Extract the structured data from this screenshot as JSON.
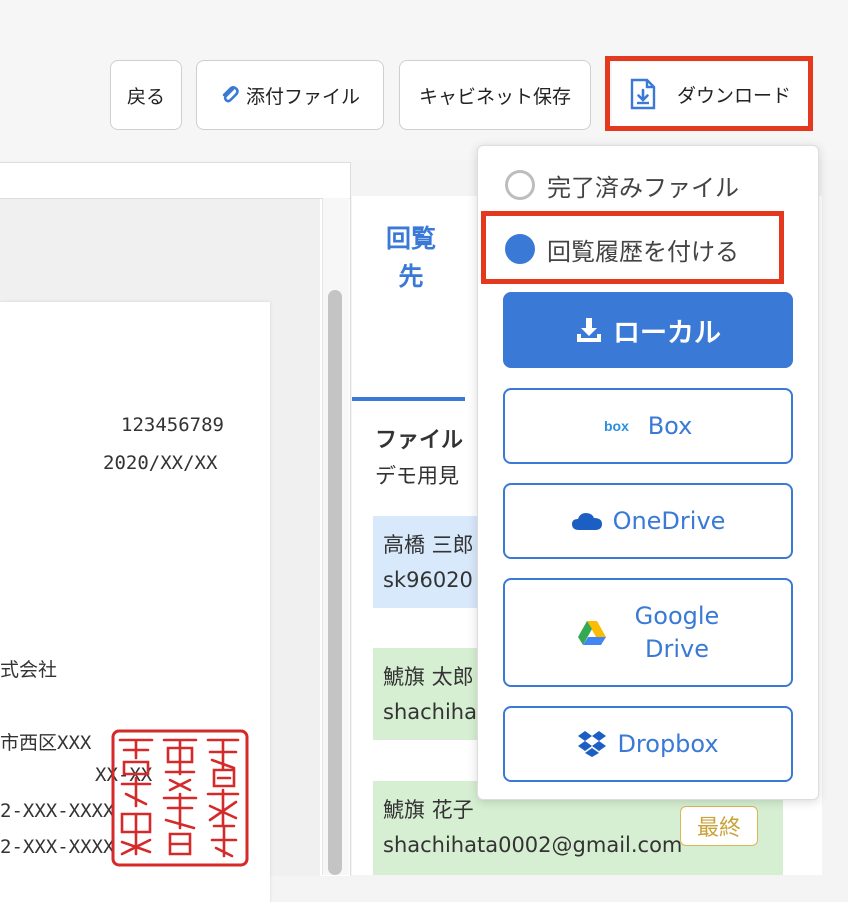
{
  "toolbar": {
    "back_label": "戻る",
    "attach_label": "添付ファイル",
    "cabinet_label": "キャビネット保存",
    "download_label": "ダウンロード"
  },
  "document": {
    "number": "123456789",
    "date": "2020/XX/XX",
    "company_fragment": "式会社",
    "address_fragment": "市西区XXX",
    "address2_fragment": "XX-XX",
    "phone1_fragment": "2-XXX-XXXX",
    "phone2_fragment": "2-XXX-XXXX"
  },
  "panel": {
    "tab_label": "回覧先",
    "file_title": "ファイル",
    "file_sub": "デモ用見",
    "recipients": [
      {
        "name": "高橋 三郎",
        "email": "sk96020"
      },
      {
        "name": "鯱旗 太郎",
        "email": "shachiha"
      },
      {
        "name": "鯱旗 花子",
        "email": "shachihata0002@gmail.com"
      }
    ],
    "final_badge": "最終"
  },
  "dropdown": {
    "option_completed": "完了済みファイル",
    "option_history": "回覧履歴を付ける",
    "local_label": "ローカル",
    "box_label": "Box",
    "onedrive_label": "OneDrive",
    "google_line1": "Google",
    "google_line2": "Drive",
    "dropbox_label": "Dropbox"
  },
  "colors": {
    "accent": "#3a7ad6",
    "highlight": "#e5391f",
    "seal": "#d42a2a"
  }
}
